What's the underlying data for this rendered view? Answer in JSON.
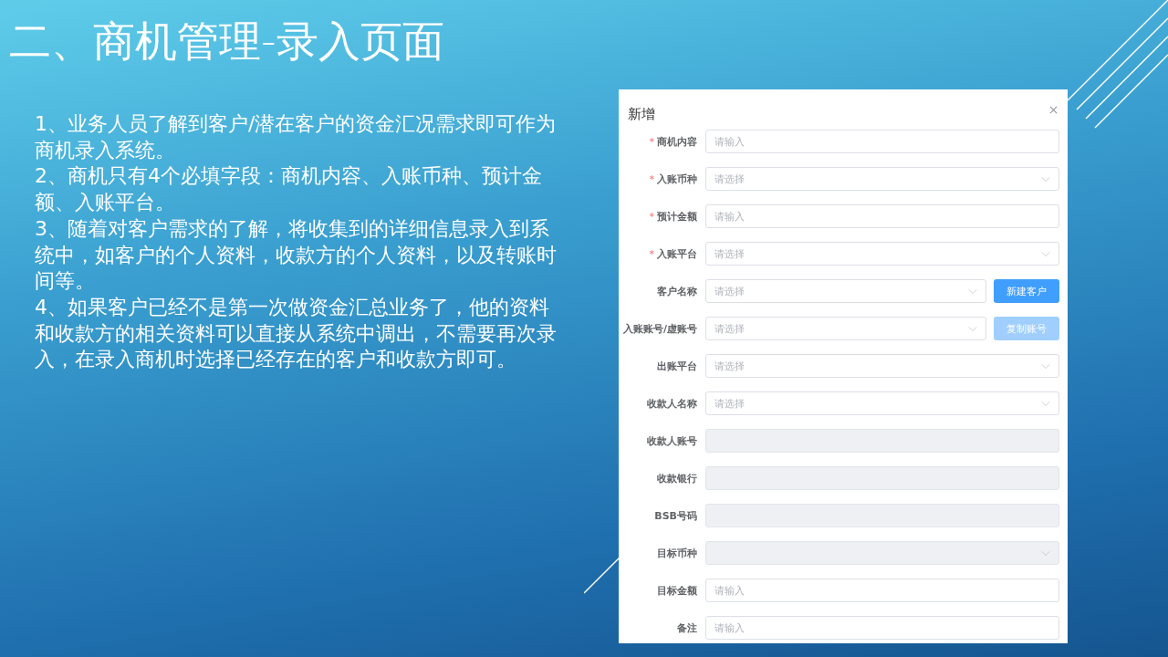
{
  "slide_title": "二、商机管理-录入页面",
  "notes": [
    "1、业务人员了解到客户/潜在客户的资金汇况需求即可作为商机录入系统。",
    "2、商机只有4个必填字段：商机内容、入账币种、预计金额、入账平台。",
    "3、随着对客户需求的了解，将收集到的详细信息录入到系统中，如客户的个人资料，收款方的个人资料，以及转账时间等。",
    "4、如果客户已经不是第一次做资金汇总业务了，他的资料和收款方的相关资料可以直接从系统中调出，不需要再次录入，在录入商机时选择已经存在的客户和收款方即可。"
  ],
  "dialog": {
    "title": "新增",
    "fields": [
      {
        "label": "商机内容",
        "required_mark": "*",
        "kind": "input",
        "placeholder": "请输入",
        "disabled": false
      },
      {
        "label": "入账币种",
        "required_mark": "*",
        "kind": "select",
        "placeholder": "请选择",
        "disabled": false
      },
      {
        "label": "预计金额",
        "required_mark": "*",
        "kind": "input",
        "placeholder": "请输入",
        "disabled": false
      },
      {
        "label": "入账平台",
        "required_mark": "*",
        "kind": "select",
        "placeholder": "请选择",
        "disabled": false
      },
      {
        "label": "客户名称",
        "kind": "select",
        "placeholder": "请选择",
        "disabled": false,
        "button": {
          "label": "新建客户",
          "disabled": false
        }
      },
      {
        "label": "入账账号/虚账号",
        "kind": "select",
        "placeholder": "请选择",
        "disabled": false,
        "button": {
          "label": "复制账号",
          "disabled": true
        }
      },
      {
        "label": "出账平台",
        "kind": "select",
        "placeholder": "请选择",
        "disabled": false
      },
      {
        "label": "收款人名称",
        "kind": "select",
        "placeholder": "请选择",
        "disabled": false
      },
      {
        "label": "收款人账号",
        "kind": "input",
        "disabled": true
      },
      {
        "label": "收款银行",
        "kind": "input",
        "disabled": true
      },
      {
        "label": "BSB号码",
        "kind": "input",
        "disabled": true
      },
      {
        "label": "目标币种",
        "kind": "select",
        "disabled": true
      },
      {
        "label": "目标金额",
        "kind": "input",
        "placeholder": "请输入",
        "disabled": false
      },
      {
        "label": "备注",
        "kind": "input",
        "placeholder": "请输入",
        "disabled": false
      }
    ]
  }
}
